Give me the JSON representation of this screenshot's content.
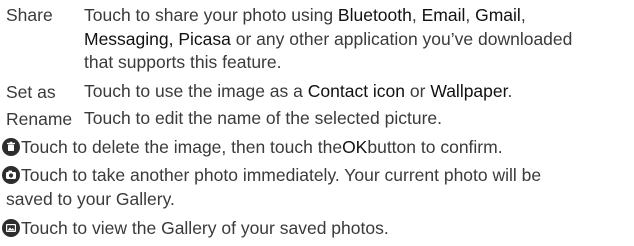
{
  "rows": [
    {
      "term": "Share",
      "desc": {
        "a": "Touch to share your photo using ",
        "b": "Bluetooth",
        "c": ", ",
        "d": "Email",
        "e": ", ",
        "f": "Gmail",
        "g": ",",
        "h": "Messaging, Picasa",
        "i": " or any other application you’ve downloaded",
        "j": "that supports this feature."
      }
    },
    {
      "term": "Set as",
      "desc": {
        "a": "Touch to use the image as a ",
        "b": "Contact icon",
        "c": " or ",
        "d": "Wallpaper",
        "e": "."
      }
    },
    {
      "term": "Rename",
      "desc": {
        "a": "Touch to edit the name of the selected picture."
      }
    }
  ],
  "icon_lines": [
    {
      "icon": "delete-icon",
      "a": "Touch to delete the image, then touch the ",
      "b": "OK",
      "c": " button to confirm."
    },
    {
      "icon": "camera-icon",
      "a": "Touch to take another photo immediately. Your current photo will be",
      "b": "saved to your Gallery."
    },
    {
      "icon": "gallery-icon",
      "a": "Touch to view the Gallery of your saved photos."
    }
  ]
}
